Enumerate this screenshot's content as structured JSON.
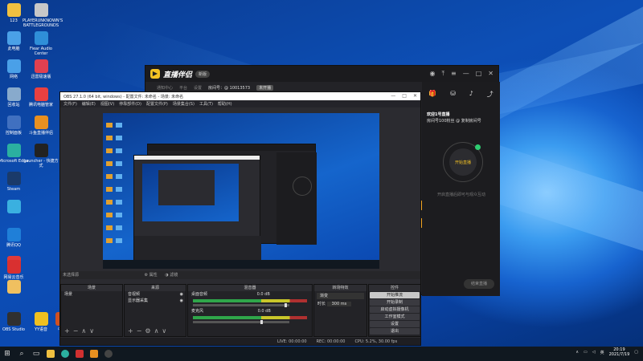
{
  "desktop": {
    "icons": [
      {
        "label": "123",
        "color": "#f0c040"
      },
      {
        "label": "PLAYERUNKNOWN'S BATTLEGROUNDS",
        "color": "#c8c8c8"
      },
      {
        "label": "此电脑",
        "color": "#4aa0e8"
      },
      {
        "label": "Fiear Audio Center",
        "color": "#2f8fd8"
      },
      {
        "label": "网络",
        "color": "#4aa0e8"
      },
      {
        "label": "迅雷极速版",
        "color": "#e04050"
      },
      {
        "label": "回收站",
        "color": "#88aacc"
      },
      {
        "label": "腾讯电脑管家",
        "color": "#e84040"
      },
      {
        "label": "控制面板",
        "color": "#4070c0"
      },
      {
        "label": "斗鱼直播伴侣",
        "color": "#e89020"
      },
      {
        "label": "Microsoft Edge",
        "color": "#2bb0a0"
      },
      {
        "label": "Launcher - 快捷方式",
        "color": "#222222"
      },
      {
        "label": "Steam",
        "color": "#1a3a6a"
      },
      {
        "label": "",
        "color": "#3ab0e0"
      },
      {
        "label": "腾讯QQ",
        "color": "#1f7fd8"
      },
      {
        "label": "",
        "color": "#e03a3a"
      },
      {
        "label": "网易云音乐",
        "color": "#d93030"
      },
      {
        "label": "",
        "color": "#f0c060"
      },
      {
        "label": "OBS Studio",
        "color": "#303030"
      },
      {
        "label": "YY语音",
        "color": "#f0c020"
      },
      {
        "label": "中...",
        "color": "#d05020"
      }
    ]
  },
  "taskbar": {
    "start_icon": "windows-icon",
    "time": "20:19",
    "date": "2021/7/19"
  },
  "zbapp": {
    "brand": "直播伴侣",
    "version_pill": "新版",
    "room_label": "房间号：@ 10013573",
    "room_tag": "未开播",
    "tabs": [
      "通知中心",
      "平台",
      "设置"
    ],
    "profile_line1": "欢迎1号直播",
    "profile_line2": "房间号100粉丝 @ 复制房间号",
    "profile_btn": "粉丝",
    "start_btn": "开始直播",
    "hint": "开启直播后即可与观众互动",
    "stop_btn": "结束直播"
  },
  "obs": {
    "title": "OBS 27.1.0 (64 bit, windows) - 配置文件: 未命名 - 场景: 未命名",
    "menu": [
      "文件(F)",
      "编辑(E)",
      "视图(V)",
      "停靠部件(D)",
      "配置文件(P)",
      "场景集合(S)",
      "工具(T)",
      "帮助(H)"
    ],
    "scene_bar": "未选择源",
    "scene_bar_props": "⚙ 属性",
    "scene_bar_filters": "◑ 滤镜",
    "docks": {
      "scenes": {
        "title": "场景",
        "items": [
          "场景"
        ]
      },
      "sources": {
        "title": "来源",
        "items": [
          "音视频",
          "显示器采集"
        ]
      },
      "mixer": {
        "title": "混音器",
        "tracks": [
          {
            "name": "桌面音频",
            "db": "0.0 dB",
            "level": 0.85
          },
          {
            "name": "麦克风",
            "db": "0.0 dB",
            "level": 0.6
          }
        ]
      },
      "transitions": {
        "title": "转场特效",
        "type": "渐变",
        "duration_label": "时长",
        "duration": "300 ms"
      },
      "controls": {
        "title": "控件",
        "buttons": [
          "开始推流",
          "开始录制",
          "启动虚拟摄像机",
          "工作室模式",
          "设置",
          "退出"
        ]
      }
    },
    "status": [
      "LIVE: 00:00:00",
      "REC: 00:00:00",
      "CPU: 5.2%, 30.00 fps"
    ]
  }
}
